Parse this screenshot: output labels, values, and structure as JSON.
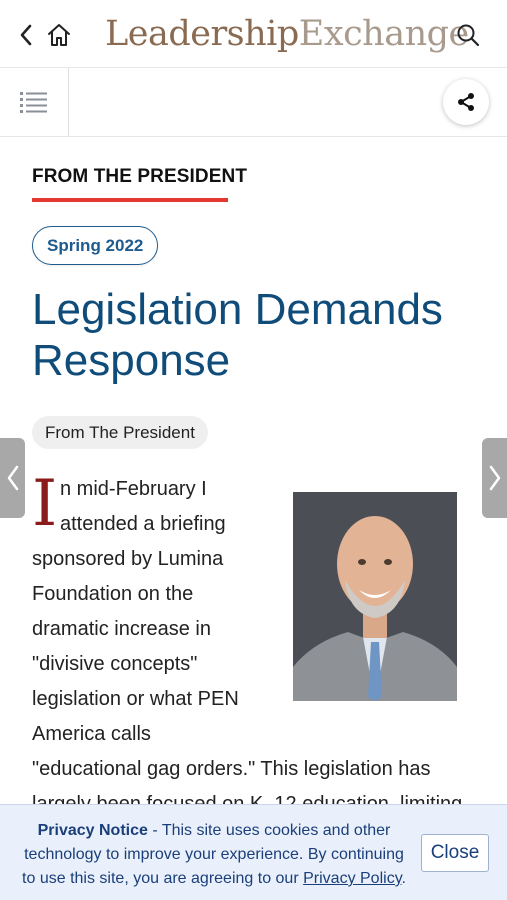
{
  "header": {
    "logo_part1": "Leadership",
    "logo_part2": "Exchange",
    "back_icon": "chevron-left-icon",
    "home_icon": "home-icon",
    "search_icon": "search-icon"
  },
  "subnav": {
    "toc_icon": "list-icon",
    "share_icon": "share-icon"
  },
  "article": {
    "section_label": "FROM THE PRESIDENT",
    "issue": "Spring 2022",
    "title": "Legislation Demands Response",
    "category": "From The President",
    "dropcap": "I",
    "lines": [
      "n mid-February I",
      "attended a briefing",
      "sponsored by Lumina",
      "Foundation on the",
      "dramatic increase in",
      "\"divisive concepts\"",
      "legislation or what PEN",
      "America calls",
      "\"educational gag orders.\" This legislation has",
      "largely been focused on K–12 education, limiting"
    ]
  },
  "privacy": {
    "label": "Privacy Notice",
    "text": " - This site uses cookies and other technology to improve your experience. By continuing to use this site, you are agreeing to our ",
    "link": "Privacy Policy",
    "end": ".",
    "close_label": "Close"
  },
  "colors": {
    "accent_red": "#e2382f",
    "title_blue": "#0f4c7a",
    "dropcap_red": "#8b1a1a",
    "banner_bg": "#e9f0fb"
  }
}
